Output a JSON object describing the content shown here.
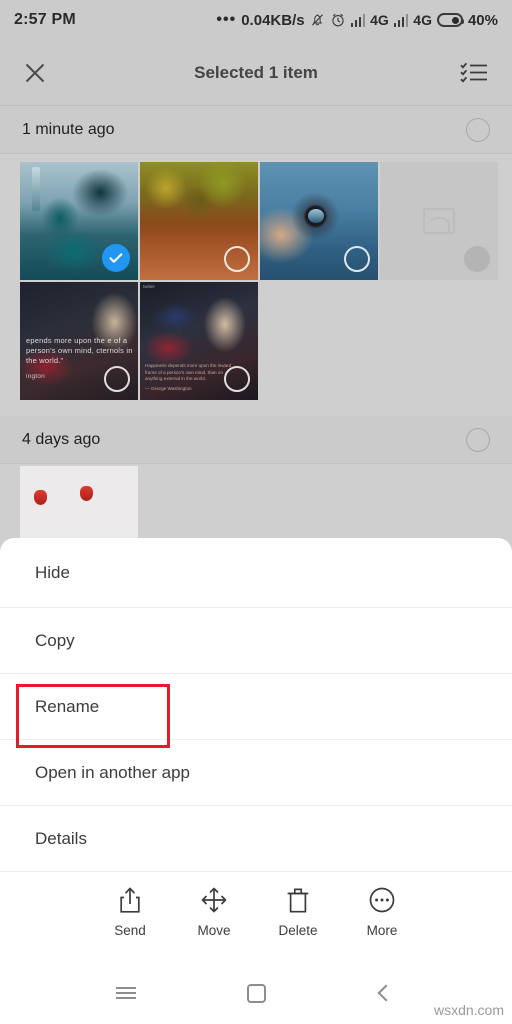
{
  "statusbar": {
    "time": "2:57 PM",
    "dots": "•••",
    "network_speed": "0.04KB/s",
    "icons": [
      "notifications-muted-icon",
      "alarm-icon",
      "signal-bars-icon",
      "signal-bars-icon"
    ],
    "sim1_network": "4G",
    "sim2_network": "4G",
    "battery_percent": "40%"
  },
  "header": {
    "close_icon": "close-icon",
    "title": "Selected 1 item",
    "select_all_icon": "select-all-checklist-icon"
  },
  "groups": [
    {
      "label": "1 minute ago",
      "selected": false,
      "photos": [
        {
          "name": "fantasy-statue-photo",
          "selected": true,
          "placeholder": false
        },
        {
          "name": "autumn-path-photo",
          "selected": false,
          "placeholder": false
        },
        {
          "name": "camera-lens-photo",
          "selected": false,
          "placeholder": false
        },
        {
          "name": "loading-placeholder",
          "selected": false,
          "placeholder": true
        },
        {
          "name": "washington-quote-photo-1",
          "selected": false,
          "placeholder": false,
          "quote": "epends more upon the e of a person's own mind, cternols in the world.\"",
          "attribution": "ington"
        },
        {
          "name": "washington-quote-photo-2",
          "selected": false,
          "placeholder": false,
          "tag": "twitter",
          "quote_small": "Happiness depends more upon the inward frame of a person's own mind, than on anything external in the world.",
          "attribution": "— George Washington"
        }
      ]
    },
    {
      "label": "4 days ago",
      "selected": false,
      "photos": [
        {
          "name": "strawberry-photo",
          "selected": false,
          "placeholder": false
        }
      ]
    }
  ],
  "sheet": {
    "menu_items": [
      {
        "label": "Hide",
        "name": "menu-item-hide"
      },
      {
        "label": "Copy",
        "name": "menu-item-copy"
      },
      {
        "label": "Rename",
        "name": "menu-item-rename",
        "highlighted": true
      },
      {
        "label": "Open in another app",
        "name": "menu-item-open-in-another-app"
      },
      {
        "label": "Details",
        "name": "menu-item-details"
      }
    ],
    "actions": [
      {
        "label": "Send",
        "icon": "share-icon",
        "name": "send-action"
      },
      {
        "label": "Move",
        "icon": "move-icon",
        "name": "move-action"
      },
      {
        "label": "Delete",
        "icon": "trash-icon",
        "name": "delete-action"
      },
      {
        "label": "More",
        "icon": "more-icon",
        "name": "more-action"
      }
    ]
  },
  "navbar": {
    "menu_icon": "menu-icon",
    "home_icon": "home-icon",
    "back_icon": "back-icon"
  },
  "watermark": "wsxdn.com",
  "colors": {
    "accent_blue": "#2196f3",
    "highlight_red": "#e8192c",
    "background_gray": "#cfcfcf",
    "sheet_white": "#ffffff"
  }
}
